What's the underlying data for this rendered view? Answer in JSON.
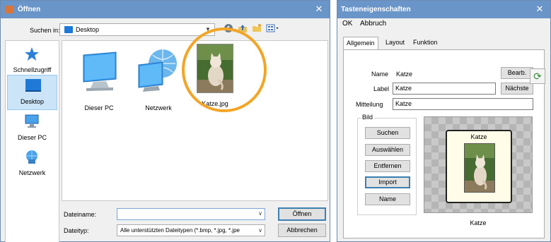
{
  "open_dialog": {
    "title": "Öffnen",
    "look_in_label": "Suchen in:",
    "look_in_value": "Desktop",
    "places": [
      {
        "label": "Schnellzugriff",
        "icon": "star-icon"
      },
      {
        "label": "Desktop",
        "icon": "desktop-icon",
        "selected": true
      },
      {
        "label": "Dieser PC",
        "icon": "computer-icon"
      },
      {
        "label": "Netzwerk",
        "icon": "network-icon"
      }
    ],
    "files": [
      {
        "label": "Dieser PC",
        "icon": "computer-icon"
      },
      {
        "label": "Netzwerk",
        "icon": "network-icon"
      },
      {
        "label": "Katze.jpg",
        "icon": "image-thumbnail",
        "highlighted": true
      }
    ],
    "filename_label": "Dateiname:",
    "filename_value": "",
    "filetype_label": "Dateityp:",
    "filetype_value": "Alle unterstützten Dateitypen (*.bmp, *.jpg, *.jpe",
    "open_button": "Öffnen",
    "cancel_button": "Abbrechen",
    "highlight_color": "#f2a527"
  },
  "props_dialog": {
    "title": "Tasteneigenschaften",
    "menu": [
      "OK",
      "Abbruch"
    ],
    "tabs": [
      "Allgemein",
      "Layout",
      "Funktion"
    ],
    "active_tab": "Allgemein",
    "name_label": "Name",
    "name_value": "Katze",
    "edit_button": "Bearb.",
    "label_label": "Label",
    "label_value": "Katze",
    "next_button": "Nächste",
    "message_label": "Mitteilung",
    "message_value": "Katze",
    "image_group_label": "Bild",
    "image_buttons": [
      "Suchen",
      "Auswählen",
      "Entfernen",
      "Import",
      "Name"
    ],
    "preview_key_label": "Katze",
    "preview_caption": "Katze"
  }
}
